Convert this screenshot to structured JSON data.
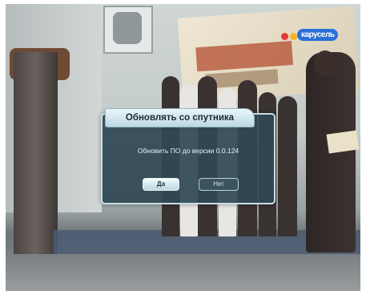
{
  "channel_logo": {
    "text": "карусель",
    "colors": [
      "#e23b3b",
      "#f2b623",
      "#2a6fd6"
    ]
  },
  "dialog": {
    "title": "Обновлять со спутника",
    "message": "Обновить ПО до версии 0.0.124",
    "buttons": {
      "yes": "Да",
      "no": "Нет"
    }
  },
  "colors": {
    "dialog_bg": "#304854",
    "dialog_border": "#c7dfe6",
    "title_bg": "#eaf6fb"
  }
}
